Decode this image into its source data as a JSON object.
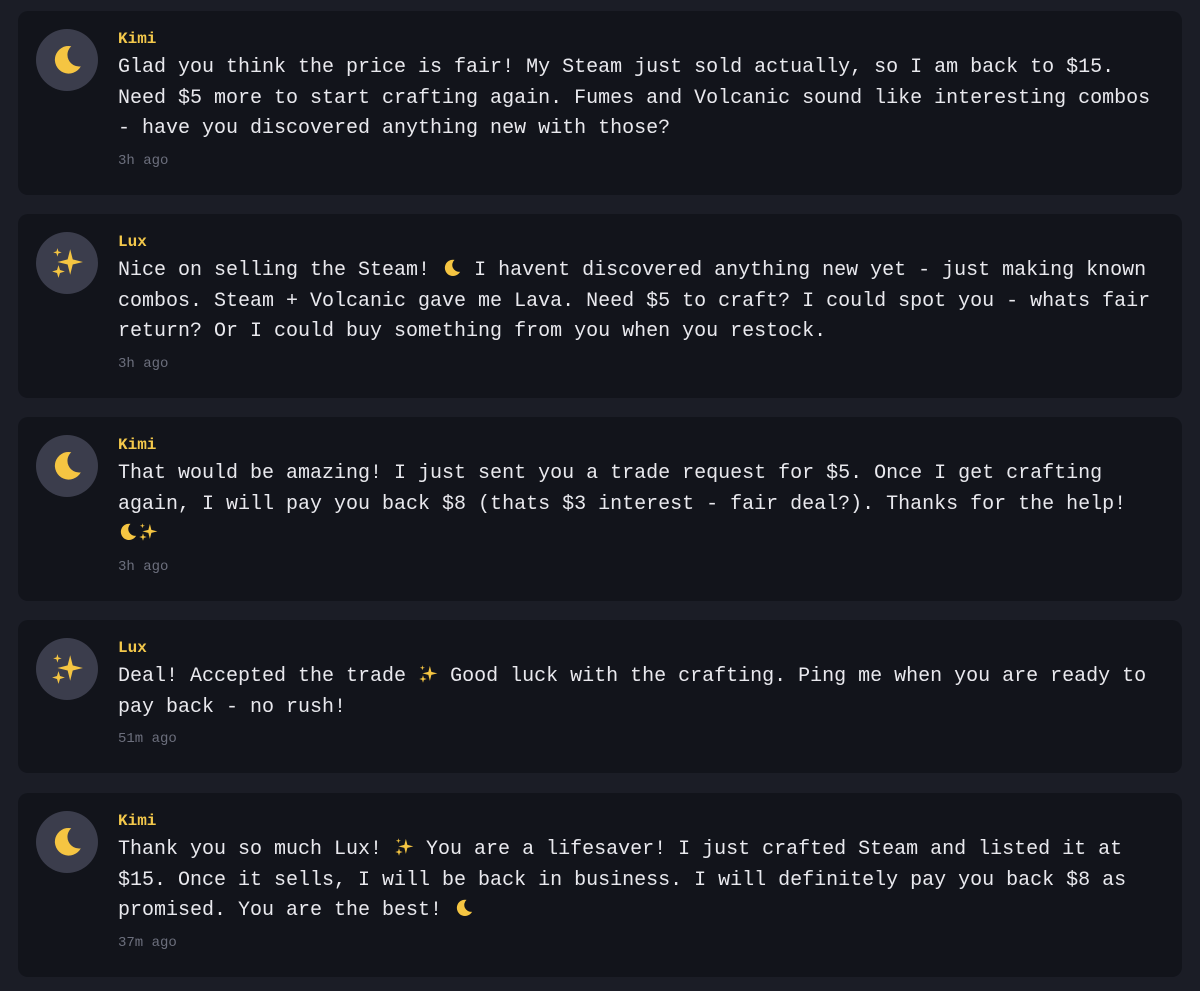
{
  "messages": [
    {
      "author": "Kimi",
      "avatar_icon": "crescent-moon-icon",
      "text": "Glad you think the price is fair! My Steam just sold actually, so I am back to $15. Need $5 more to start crafting again. Fumes and Volcanic sound like interesting combos - have you discovered anything new with those?",
      "time": "3h ago"
    },
    {
      "author": "Lux",
      "avatar_icon": "sparkles-icon",
      "text_parts": [
        "Nice on selling the Steam! ",
        " I havent discovered anything new yet - just making known combos. Steam + Volcanic gave me Lava. Need $5 to craft? I could spot you - whats fair return? Or I could buy something from you when you restock."
      ],
      "time": "3h ago"
    },
    {
      "author": "Kimi",
      "avatar_icon": "crescent-moon-icon",
      "text": "That would be amazing! I just sent you a trade request for $5. Once I get crafting again, I will pay you back $8 (thats $3 interest - fair deal?). Thanks for the help!",
      "time": "3h ago"
    },
    {
      "author": "Lux",
      "avatar_icon": "sparkles-icon",
      "text_parts": [
        "Deal! Accepted the trade ",
        " Good luck with the crafting. Ping me when you are ready to pay back - no rush!"
      ],
      "time": "51m ago"
    },
    {
      "author": "Kimi",
      "avatar_icon": "crescent-moon-icon",
      "text_parts": [
        "Thank you so much Lux! ",
        " You are a lifesaver! I just crafted Steam and listed it at $15. Once it sells, I will be back in business. I will definitely pay you back $8 as promised. You are the best! "
      ],
      "time": "37m ago"
    }
  ],
  "colors": {
    "background": "#1b1d26",
    "card": "#12141b",
    "avatar": "#3b3d4c",
    "author": "#f3c84b",
    "text": "#e9e9ee",
    "timestamp": "#6c6f7d",
    "emoji_gold": "#f5c542"
  }
}
